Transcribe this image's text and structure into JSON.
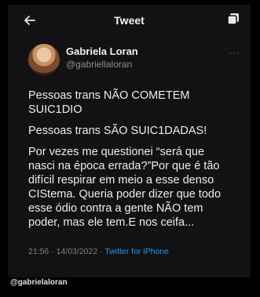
{
  "header": {
    "title": "Tweet",
    "back_icon": "arrow-left-icon",
    "corner_icon": "layers-icon"
  },
  "tweet": {
    "author_name": "Gabriela Loran",
    "author_handle": "@gabriellaloran",
    "more_label": "···",
    "paragraphs": [
      "Pessoas trans NÃO COMETEM\nSUIC1DIO",
      "Pessoas trans SÃO SUIC1DADAS!",
      "Por vezes me questionei “será que\nnasci na época errada?”Por que é tão\ndifícil respirar em meio a esse denso\nCIStema. Queria poder dizer que todo\nesse ódio contra a gente NÃO tem\npoder, mas ele tem.E nos ceifa..."
    ],
    "timestamp": "21:56 · 14/03/2022 · ",
    "source": "Twitter for iPhone"
  },
  "watermark": "@gabrielaloran",
  "colors": {
    "background": "#000000",
    "card": "#121214",
    "link": "#1d9bf0",
    "muted": "#8b8f94"
  }
}
